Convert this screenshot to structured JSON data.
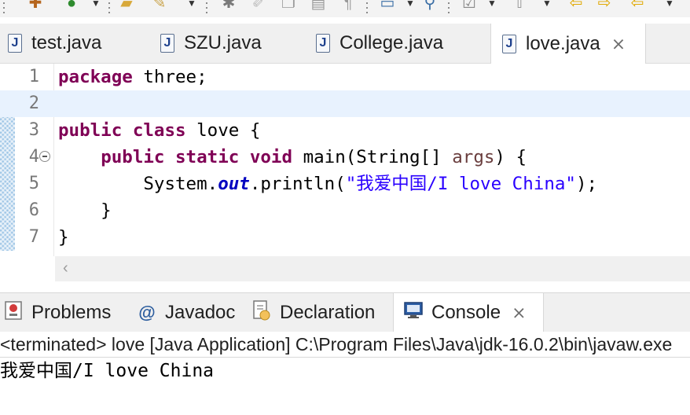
{
  "toolbar": {
    "icons": [
      "new-wizard-icon",
      "refresh-icon",
      "open-folder-icon",
      "brush-icon",
      "debug-icon",
      "pen-icon",
      "copy-icon",
      "clipboard-icon",
      "pilcrow-icon",
      "monitor-icon",
      "search-icon",
      "checklist-icon",
      "up-arrow-icon",
      "back-arrow-icon",
      "forward-arrow-icon",
      "previous-edit-icon"
    ]
  },
  "editor_tabs": [
    {
      "label": "test.java",
      "icon": "J"
    },
    {
      "label": "SZU.java",
      "icon": "J"
    },
    {
      "label": "College.java",
      "icon": "J"
    },
    {
      "label": "love.java",
      "icon": "J",
      "close": "⨯"
    }
  ],
  "editor": {
    "line_numbers": [
      "1",
      "2",
      "3",
      "4",
      "5",
      "6",
      "7"
    ],
    "line1": {
      "kw": "package",
      "rest": " three;"
    },
    "line3": {
      "kw1": "public",
      "kw2": "class",
      "rest": " love {"
    },
    "line4": {
      "indent": "    ",
      "kw1": "public",
      "kw2": "static",
      "kw3": "void",
      "mid": " main(String[] ",
      "param": "args",
      "end": ") {"
    },
    "line5": {
      "indent": "        ",
      "pre": "System.",
      "field": "out",
      "mid": ".println(",
      "string": "\"我爱中国/I love China\"",
      "end": ");"
    },
    "line6": "    }",
    "line7": "}",
    "scroll_left": "‹"
  },
  "view_tabs": [
    {
      "label": "Problems",
      "icon": "problems-icon"
    },
    {
      "label": "Javadoc",
      "icon_text": "@"
    },
    {
      "label": "Declaration",
      "icon": "declaration-icon"
    },
    {
      "label": "Console",
      "icon": "console-icon",
      "close": "⨯"
    }
  ],
  "console": {
    "header": "<terminated> love [Java Application] C:\\Program Files\\Java\\jdk-16.0.2\\bin\\javaw.exe",
    "output": "我爱中国/I love China"
  }
}
